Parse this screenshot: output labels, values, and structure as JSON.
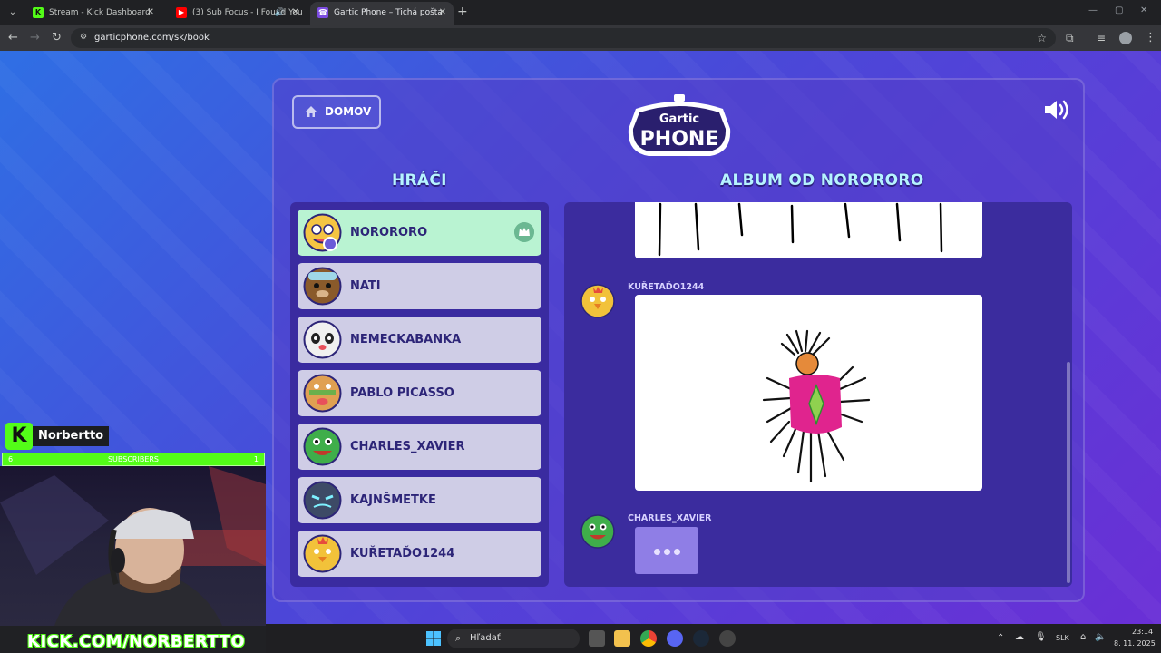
{
  "browser": {
    "tabs": [
      {
        "title": "Stream - Kick Dashboard",
        "active": false
      },
      {
        "title": "(3) Sub Focus - I Found You",
        "active": false
      },
      {
        "title": "Gartic Phone – Tichá pošta",
        "active": true
      }
    ],
    "url": "garticphone.com/sk/book"
  },
  "game": {
    "home_label": "DOMOV",
    "logo_top": "Gartic",
    "logo_bottom": "PHONE",
    "players_title": "HRÁČI",
    "album_title": "ALBUM OD NORORORO",
    "players": [
      {
        "name": "NORORORO",
        "host": true,
        "color": "#f5c542"
      },
      {
        "name": "NATI",
        "host": false,
        "color": "#8a5a2b"
      },
      {
        "name": "NEMECKABANKA",
        "host": false,
        "color": "#f0f0f0"
      },
      {
        "name": "PABLO PICASSO",
        "host": false,
        "color": "#e0a052"
      },
      {
        "name": "CHARLES_XAVIER",
        "host": false,
        "color": "#3fae4a"
      },
      {
        "name": "KAJNŠMETKE",
        "host": false,
        "color": "#3d4a66"
      },
      {
        "name": "KUŘETAĎO1244",
        "host": false,
        "color": "#f2c23a"
      }
    ],
    "album": {
      "entries": [
        {
          "author": "KUŘETAĎO1244",
          "type": "drawing"
        },
        {
          "author": "CHARLES_XAVIER",
          "type": "typing"
        }
      ]
    }
  },
  "stream_overlay": {
    "streamer": "Norbertto",
    "subs_label": "SUBSCRIBERS",
    "subs_left": "6",
    "subs_right": "1",
    "kick_url": "KICK.COM/NORBERTTO"
  },
  "taskbar": {
    "search_placeholder": "Hľadať",
    "language": "SLK",
    "time": "23:14",
    "date": "8. 11. 2025"
  },
  "colors": {
    "kick_green": "#53fc18",
    "title_cyan": "#b6f3ff",
    "host_row": "#b9f3d2",
    "player_row": "#cfcde6"
  }
}
